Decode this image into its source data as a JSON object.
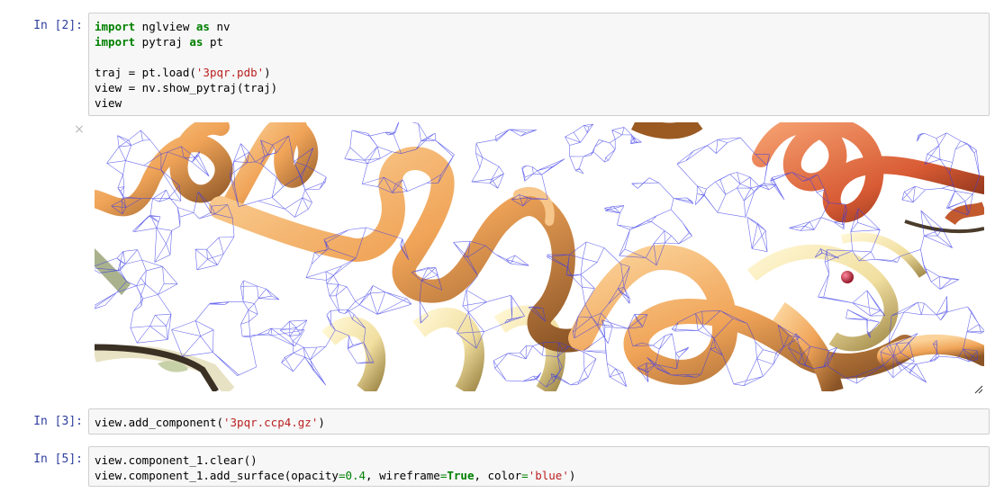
{
  "cells": [
    {
      "prompt": "In [2]:",
      "lines": [
        [
          {
            "t": "import",
            "c": "kw"
          },
          {
            "t": " nglview ",
            "c": ""
          },
          {
            "t": "as",
            "c": "kw"
          },
          {
            "t": " nv",
            "c": ""
          }
        ],
        [
          {
            "t": "import",
            "c": "kw"
          },
          {
            "t": " pytraj ",
            "c": ""
          },
          {
            "t": "as",
            "c": "kw"
          },
          {
            "t": " pt",
            "c": ""
          }
        ],
        [],
        [
          {
            "t": "traj = pt.load(",
            "c": ""
          },
          {
            "t": "'3pqr.pdb'",
            "c": "str"
          },
          {
            "t": ")",
            "c": ""
          }
        ],
        [
          {
            "t": "view = nv.show_pytraj(traj)",
            "c": ""
          }
        ],
        [
          {
            "t": "view",
            "c": ""
          }
        ]
      ]
    },
    {
      "prompt": "In [3]:",
      "lines": [
        [
          {
            "t": "view.add_component(",
            "c": ""
          },
          {
            "t": "'3pqr.ccp4.gz'",
            "c": "str"
          },
          {
            "t": ")",
            "c": ""
          }
        ]
      ]
    },
    {
      "prompt": "In [5]:",
      "lines": [
        [
          {
            "t": "view.component_1.clear()",
            "c": ""
          }
        ],
        [
          {
            "t": "view.component_1.add_surface(opacity",
            "c": ""
          },
          {
            "t": "=",
            "c": "op"
          },
          {
            "t": "0.4",
            "c": "num"
          },
          {
            "t": ", wireframe",
            "c": ""
          },
          {
            "t": "=",
            "c": "op"
          },
          {
            "t": "True",
            "c": "kwc"
          },
          {
            "t": ", color",
            "c": ""
          },
          {
            "t": "=",
            "c": "op"
          },
          {
            "t": "'blue'",
            "c": "str"
          },
          {
            "t": ")",
            "c": ""
          }
        ]
      ]
    }
  ],
  "output": {
    "close_glyph": "×",
    "viewer": {
      "wireframe_color": "#3b3bea",
      "helix_color": "#f2a65a",
      "helix_light_color": "#f6e3a8",
      "helix_red_color": "#e0643c",
      "ligand_color": "#b8202a"
    }
  },
  "icons": {
    "close": "close-icon",
    "resize": "resize-handle-icon"
  }
}
